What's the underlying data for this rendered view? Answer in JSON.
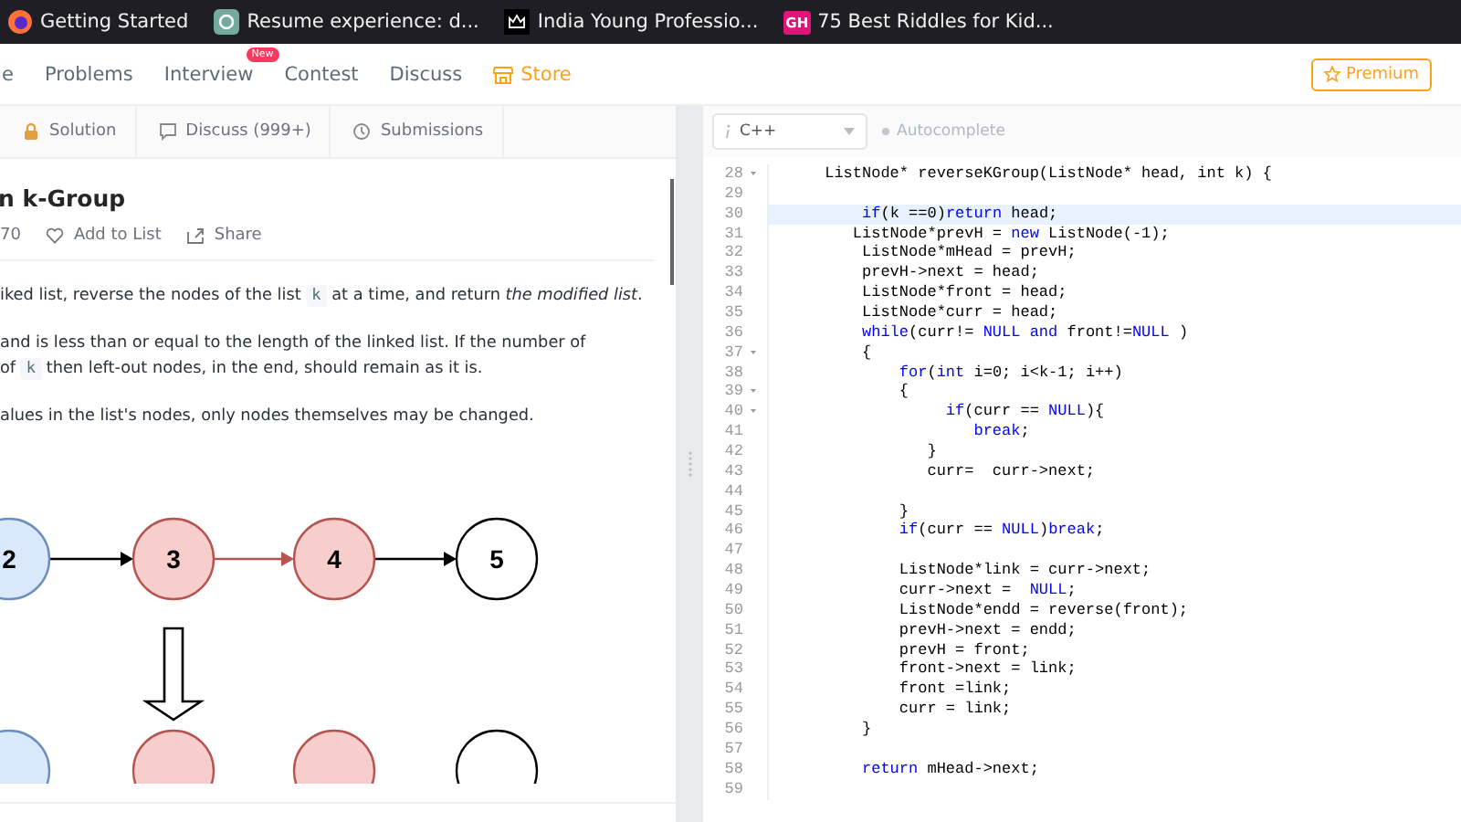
{
  "bookmarks": [
    {
      "label": "Getting Started",
      "kind": "fox"
    },
    {
      "label": "Resume experience: d...",
      "kind": "chat"
    },
    {
      "label": "India Young Professio...",
      "kind": "crown"
    },
    {
      "label": "75 Best Riddles for Kid...",
      "kind": "badge",
      "badge": "GH"
    }
  ],
  "nav": {
    "items": [
      {
        "label": "e",
        "kind": "link"
      },
      {
        "label": "Problems",
        "kind": "link"
      },
      {
        "label": "Interview",
        "kind": "link",
        "badge": "New"
      },
      {
        "label": "Contest",
        "kind": "link"
      },
      {
        "label": "Discuss",
        "kind": "link"
      },
      {
        "label": "Store",
        "kind": "store"
      }
    ],
    "premium": "Premium"
  },
  "problem_tabs": [
    {
      "label": "Solution",
      "kind": "lock"
    },
    {
      "label": "Discuss (999+)",
      "kind": "comment"
    },
    {
      "label": "Submissions",
      "kind": "clock"
    }
  ],
  "problem": {
    "title": "n k-Group",
    "likes": "70",
    "actions": [
      {
        "label": "Add to List",
        "kind": "heart"
      },
      {
        "label": "Share",
        "kind": "share"
      }
    ],
    "paragraphs": [
      [
        {
          "kind": "text",
          "text": "iked list, reverse the nodes of the list "
        },
        {
          "kind": "code",
          "text": "k"
        },
        {
          "kind": "text",
          "text": " at a time, and return *the modified list*."
        }
      ],
      [
        {
          "kind": "text",
          "text": "and is less than or equal to the length of the linked list. If the number of"
        },
        {
          "kind": "break"
        },
        {
          "kind": "text",
          "text": "of "
        },
        {
          "kind": "code",
          "text": "k"
        },
        {
          "kind": "text",
          "text": " then left-out nodes, in the end, should remain as it is."
        }
      ],
      [
        {
          "kind": "text",
          "text": "alues in the list's nodes, only nodes themselves may be changed."
        }
      ]
    ],
    "diagram": {
      "nodes": [
        {
          "label": "2",
          "color": "#dae8fc"
        },
        {
          "label": "3",
          "color": "#f8cecc"
        },
        {
          "label": "4",
          "color": "#f8cecc"
        },
        {
          "label": "5"
        }
      ],
      "links": [
        {
          "color": "#000000"
        },
        {
          "color": "#b85450"
        },
        {
          "color": "#000000"
        }
      ],
      "bottom_nodes": [
        {
          "kind": "filled",
          "color": "#dae8fc"
        },
        {
          "kind": "filled",
          "color": "#f8cecc"
        },
        {
          "kind": "filled",
          "color": "#f8cecc"
        },
        {
          "kind": "plain"
        }
      ]
    }
  },
  "editor": {
    "language": "C++",
    "autocomplete": "Autocomplete",
    "lines": [
      {
        "num": "28",
        "fold": true,
        "highlight": false,
        "segments": [
          {
            "kind": "plain",
            "text": "      ListNode* reverseKGroup(ListNode* head, int k) {"
          }
        ]
      },
      {
        "num": "29",
        "fold": false,
        "highlight": false
      },
      {
        "num": "30",
        "fold": false,
        "highlight": true,
        "segments": [
          {
            "kind": "kw",
            "text": "          if"
          },
          {
            "kind": "plain",
            "text": "(k ==0)"
          },
          {
            "kind": "kw",
            "text": "return"
          },
          {
            "kind": "plain",
            "text": " head;"
          }
        ]
      },
      {
        "num": "31",
        "fold": false,
        "highlight": false,
        "segments": [
          {
            "kind": "plain",
            "text": "         ListNode*prevH = "
          },
          {
            "kind": "kw",
            "text": "new"
          },
          {
            "kind": "plain",
            "text": " ListNode(-1);"
          }
        ]
      },
      {
        "num": "32",
        "fold": false,
        "highlight": false,
        "segments": [
          {
            "kind": "plain",
            "text": "          ListNode*mHead = prevH;"
          }
        ]
      },
      {
        "num": "33",
        "fold": false,
        "highlight": false,
        "segments": [
          {
            "kind": "plain",
            "text": "          prevH->next = head;"
          }
        ]
      },
      {
        "num": "34",
        "fold": false,
        "highlight": false,
        "segments": [
          {
            "kind": "plain",
            "text": "          ListNode*front = head;"
          }
        ]
      },
      {
        "num": "35",
        "fold": false,
        "highlight": false,
        "segments": [
          {
            "kind": "plain",
            "text": "          ListNode*curr = head;"
          }
        ]
      },
      {
        "num": "36",
        "fold": false,
        "highlight": false,
        "segments": [
          {
            "kind": "kw",
            "text": "          while"
          },
          {
            "kind": "plain",
            "text": "(curr!= "
          },
          {
            "kind": "kw",
            "text": "NULL and"
          },
          {
            "kind": "plain",
            "text": " front!="
          },
          {
            "kind": "kw",
            "text": "NULL"
          },
          {
            "kind": "plain",
            "text": " )"
          }
        ]
      },
      {
        "num": "37",
        "fold": true,
        "highlight": false,
        "segments": [
          {
            "kind": "plain",
            "text": "          {"
          }
        ]
      },
      {
        "num": "38",
        "fold": false,
        "highlight": false,
        "segments": [
          {
            "kind": "kw",
            "text": "              for"
          },
          {
            "kind": "plain",
            "text": "("
          },
          {
            "kind": "kw",
            "text": "int"
          },
          {
            "kind": "plain",
            "text": " i=0; i<k-1; i++)"
          }
        ]
      },
      {
        "num": "39",
        "fold": true,
        "highlight": false,
        "segments": [
          {
            "kind": "plain",
            "text": "              {"
          }
        ]
      },
      {
        "num": "40",
        "fold": true,
        "highlight": false,
        "segments": [
          {
            "kind": "kw",
            "text": "                   if"
          },
          {
            "kind": "plain",
            "text": "(curr == "
          },
          {
            "kind": "kw",
            "text": "NULL"
          },
          {
            "kind": "plain",
            "text": "){"
          }
        ]
      },
      {
        "num": "41",
        "fold": false,
        "highlight": false,
        "segments": [
          {
            "kind": "kw",
            "text": "                      break"
          },
          {
            "kind": "plain",
            "text": ";"
          }
        ]
      },
      {
        "num": "42",
        "fold": false,
        "highlight": false,
        "segments": [
          {
            "kind": "plain",
            "text": "                 }"
          }
        ]
      },
      {
        "num": "43",
        "fold": false,
        "highlight": false,
        "segments": [
          {
            "kind": "plain",
            "text": "                 curr=  curr->next;"
          }
        ]
      },
      {
        "num": "44",
        "fold": false,
        "highlight": false
      },
      {
        "num": "45",
        "fold": false,
        "highlight": false,
        "segments": [
          {
            "kind": "plain",
            "text": "              }"
          }
        ]
      },
      {
        "num": "46",
        "fold": false,
        "highlight": false,
        "segments": [
          {
            "kind": "kw",
            "text": "              if"
          },
          {
            "kind": "plain",
            "text": "(curr == "
          },
          {
            "kind": "kw",
            "text": "NULL"
          },
          {
            "kind": "plain",
            "text": ")"
          },
          {
            "kind": "kw",
            "text": "break"
          },
          {
            "kind": "plain",
            "text": ";"
          }
        ]
      },
      {
        "num": "47",
        "fold": false,
        "highlight": false
      },
      {
        "num": "48",
        "fold": false,
        "highlight": false,
        "segments": [
          {
            "kind": "plain",
            "text": "              ListNode*link = curr->next;"
          }
        ]
      },
      {
        "num": "49",
        "fold": false,
        "highlight": false,
        "segments": [
          {
            "kind": "plain",
            "text": "              curr->next =  "
          },
          {
            "kind": "kw",
            "text": "NULL"
          },
          {
            "kind": "plain",
            "text": ";"
          }
        ]
      },
      {
        "num": "50",
        "fold": false,
        "highlight": false,
        "segments": [
          {
            "kind": "plain",
            "text": "              ListNode*endd = reverse(front);"
          }
        ]
      },
      {
        "num": "51",
        "fold": false,
        "highlight": false,
        "segments": [
          {
            "kind": "plain",
            "text": "              prevH->next = endd;"
          }
        ]
      },
      {
        "num": "52",
        "fold": false,
        "highlight": false,
        "segments": [
          {
            "kind": "plain",
            "text": "              prevH = front;"
          }
        ]
      },
      {
        "num": "53",
        "fold": false,
        "highlight": false,
        "segments": [
          {
            "kind": "plain",
            "text": "              front->next = link;"
          }
        ]
      },
      {
        "num": "54",
        "fold": false,
        "highlight": false,
        "segments": [
          {
            "kind": "plain",
            "text": "              front =link;"
          }
        ]
      },
      {
        "num": "55",
        "fold": false,
        "highlight": false,
        "segments": [
          {
            "kind": "plain",
            "text": "              curr = link;"
          }
        ]
      },
      {
        "num": "56",
        "fold": false,
        "highlight": false,
        "segments": [
          {
            "kind": "plain",
            "text": "          }"
          }
        ]
      },
      {
        "num": "57",
        "fold": false,
        "highlight": false
      },
      {
        "num": "58",
        "fold": false,
        "highlight": false,
        "segments": [
          {
            "kind": "kw",
            "text": "          return"
          },
          {
            "kind": "plain",
            "text": " mHead->next;"
          }
        ]
      },
      {
        "num": "59",
        "fold": false,
        "highlight": false
      }
    ]
  }
}
